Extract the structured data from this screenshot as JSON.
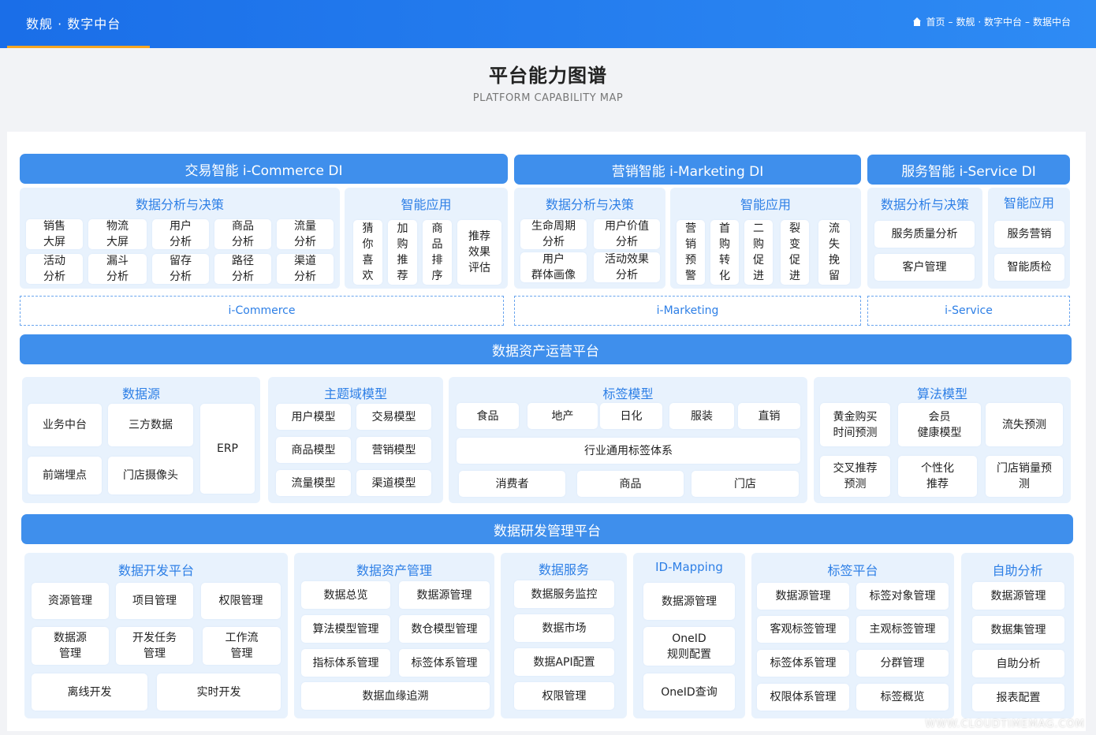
{
  "header": {
    "brand": "数舰 · 数字中台",
    "breadcrumb": [
      "首页",
      "–",
      "数舰 · 数字中台",
      "–",
      "数据中台"
    ]
  },
  "title": "平台能力图谱",
  "subtitle": "PLATFORM CAPABILITY MAP",
  "domains": {
    "commerce": {
      "title": "交易智能 i-Commerce DI",
      "analysis_title": "数据分析与决策",
      "analysis_items": [
        "销售\n大屏",
        "物流\n大屏",
        "用户\n分析",
        "商品\n分析",
        "流量\n分析",
        "活动\n分析",
        "漏斗\n分析",
        "留存\n分析",
        "路径\n分析",
        "渠道\n分析"
      ],
      "apps_title": "智能应用",
      "apps_items": [
        "猜\n你\n喜\n欢",
        "加\n购\n推\n荐",
        "商\n品\n排\n序",
        "推荐\n效果\n评估"
      ],
      "footer": "i-Commerce"
    },
    "marketing": {
      "title": "营销智能 i-Marketing DI",
      "analysis_title": "数据分析与决策",
      "analysis_items": [
        "生命周期\n分析",
        "用户价值\n分析",
        "用户\n群体画像",
        "活动效果\n分析"
      ],
      "apps_title": "智能应用",
      "apps_items": [
        "营\n销\n预\n警",
        "首\n购\n转\n化",
        "二\n购\n促\n进",
        "裂\n变\n促\n进",
        "流\n失\n挽\n留"
      ],
      "footer": "i-Marketing"
    },
    "service": {
      "title": "服务智能 i-Service DI",
      "analysis_title": "数据分析与决策",
      "analysis_items": [
        "服务质量分析",
        "客户管理"
      ],
      "apps_title": "智能应用",
      "apps_items": [
        "服务营销",
        "智能质检"
      ],
      "footer": "i-Service"
    }
  },
  "asset_platform": {
    "title": "数据资产运营平台",
    "datasource": {
      "title": "数据源",
      "items": [
        "业务中台",
        "三方数据",
        "ERP",
        "前端埋点",
        "门店摄像头"
      ]
    },
    "subject": {
      "title": "主题域模型",
      "items": [
        "用户模型",
        "交易模型",
        "商品模型",
        "营销模型",
        "流量模型",
        "渠道模型"
      ]
    },
    "tag_model": {
      "title": "标签模型",
      "row1": [
        "食品",
        "地产",
        "日化",
        "服装",
        "直销"
      ],
      "row2": "行业通用标签体系",
      "row3": [
        "消费者",
        "商品",
        "门店"
      ]
    },
    "algo": {
      "title": "算法模型",
      "items": [
        "黄金购买\n时间预测",
        "会员\n健康模型",
        "流失预测",
        "交叉推荐\n预测",
        "个性化\n推荐",
        "门店销量预\n测"
      ]
    }
  },
  "dev_platform": {
    "title": "数据研发管理平台",
    "dev": {
      "title": "数据开发平台",
      "items": [
        "资源管理",
        "项目管理",
        "权限管理",
        "数据源\n管理",
        "开发任务\n管理",
        "工作流\n管理",
        "离线开发",
        "实时开发"
      ]
    },
    "asset_mgmt": {
      "title": "数据资产管理",
      "items": [
        "数据总览",
        "数据源管理",
        "算法模型管理",
        "数仓模型管理",
        "指标体系管理",
        "标签体系管理",
        "数据血缘追溯"
      ]
    },
    "service": {
      "title": "数据服务",
      "items": [
        "数据服务监控",
        "数据市场",
        "数据API配置",
        "权限管理"
      ]
    },
    "idmapping": {
      "title": "ID-Mapping",
      "items": [
        "数据源管理",
        "OneID\n规则配置",
        "OneID查询"
      ]
    },
    "tag_platform": {
      "title": "标签平台",
      "items": [
        "数据源管理",
        "标签对象管理",
        "客观标签管理",
        "主观标签管理",
        "标签体系管理",
        "分群管理",
        "权限体系管理",
        "标签概览"
      ]
    },
    "selfservice": {
      "title": "自助分析",
      "items": [
        "数据源管理",
        "数据集管理",
        "自助分析",
        "报表配置"
      ]
    }
  },
  "watermark": "WWW.CLOUDTIMEMAG.COM"
}
